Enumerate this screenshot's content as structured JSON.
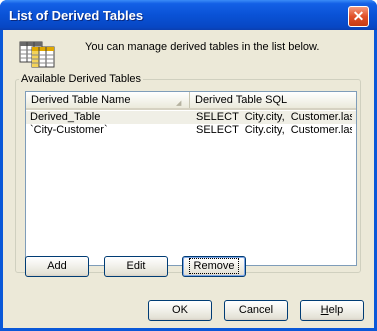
{
  "window": {
    "title": "List of Derived Tables",
    "close_glyph": "✕"
  },
  "intro_text": "You can manage derived tables in the list below.",
  "group": {
    "label": "Available Derived Tables",
    "columns": [
      "Derived Table Name",
      "Derived Table SQL"
    ],
    "sort_glyph": "◢",
    "rows": [
      {
        "name": "Derived_Table",
        "sql": "SELECT  City.city,  Customer.last_..."
      },
      {
        "name": "`City-Customer`",
        "sql": "SELECT  City.city,  Customer.last_..."
      }
    ]
  },
  "actions": {
    "add": "Add",
    "edit": "Edit",
    "remove": "Remove"
  },
  "footer": {
    "ok": "OK",
    "cancel": "Cancel",
    "help_prefix": "H",
    "help_rest": "elp"
  },
  "colors": {
    "titlebar": "#0a52d6",
    "dialog_bg": "#ece9d8",
    "button_border": "#003c74"
  },
  "icons": {
    "dialog_icon": "derived-tables-icon",
    "close": "close-icon"
  }
}
